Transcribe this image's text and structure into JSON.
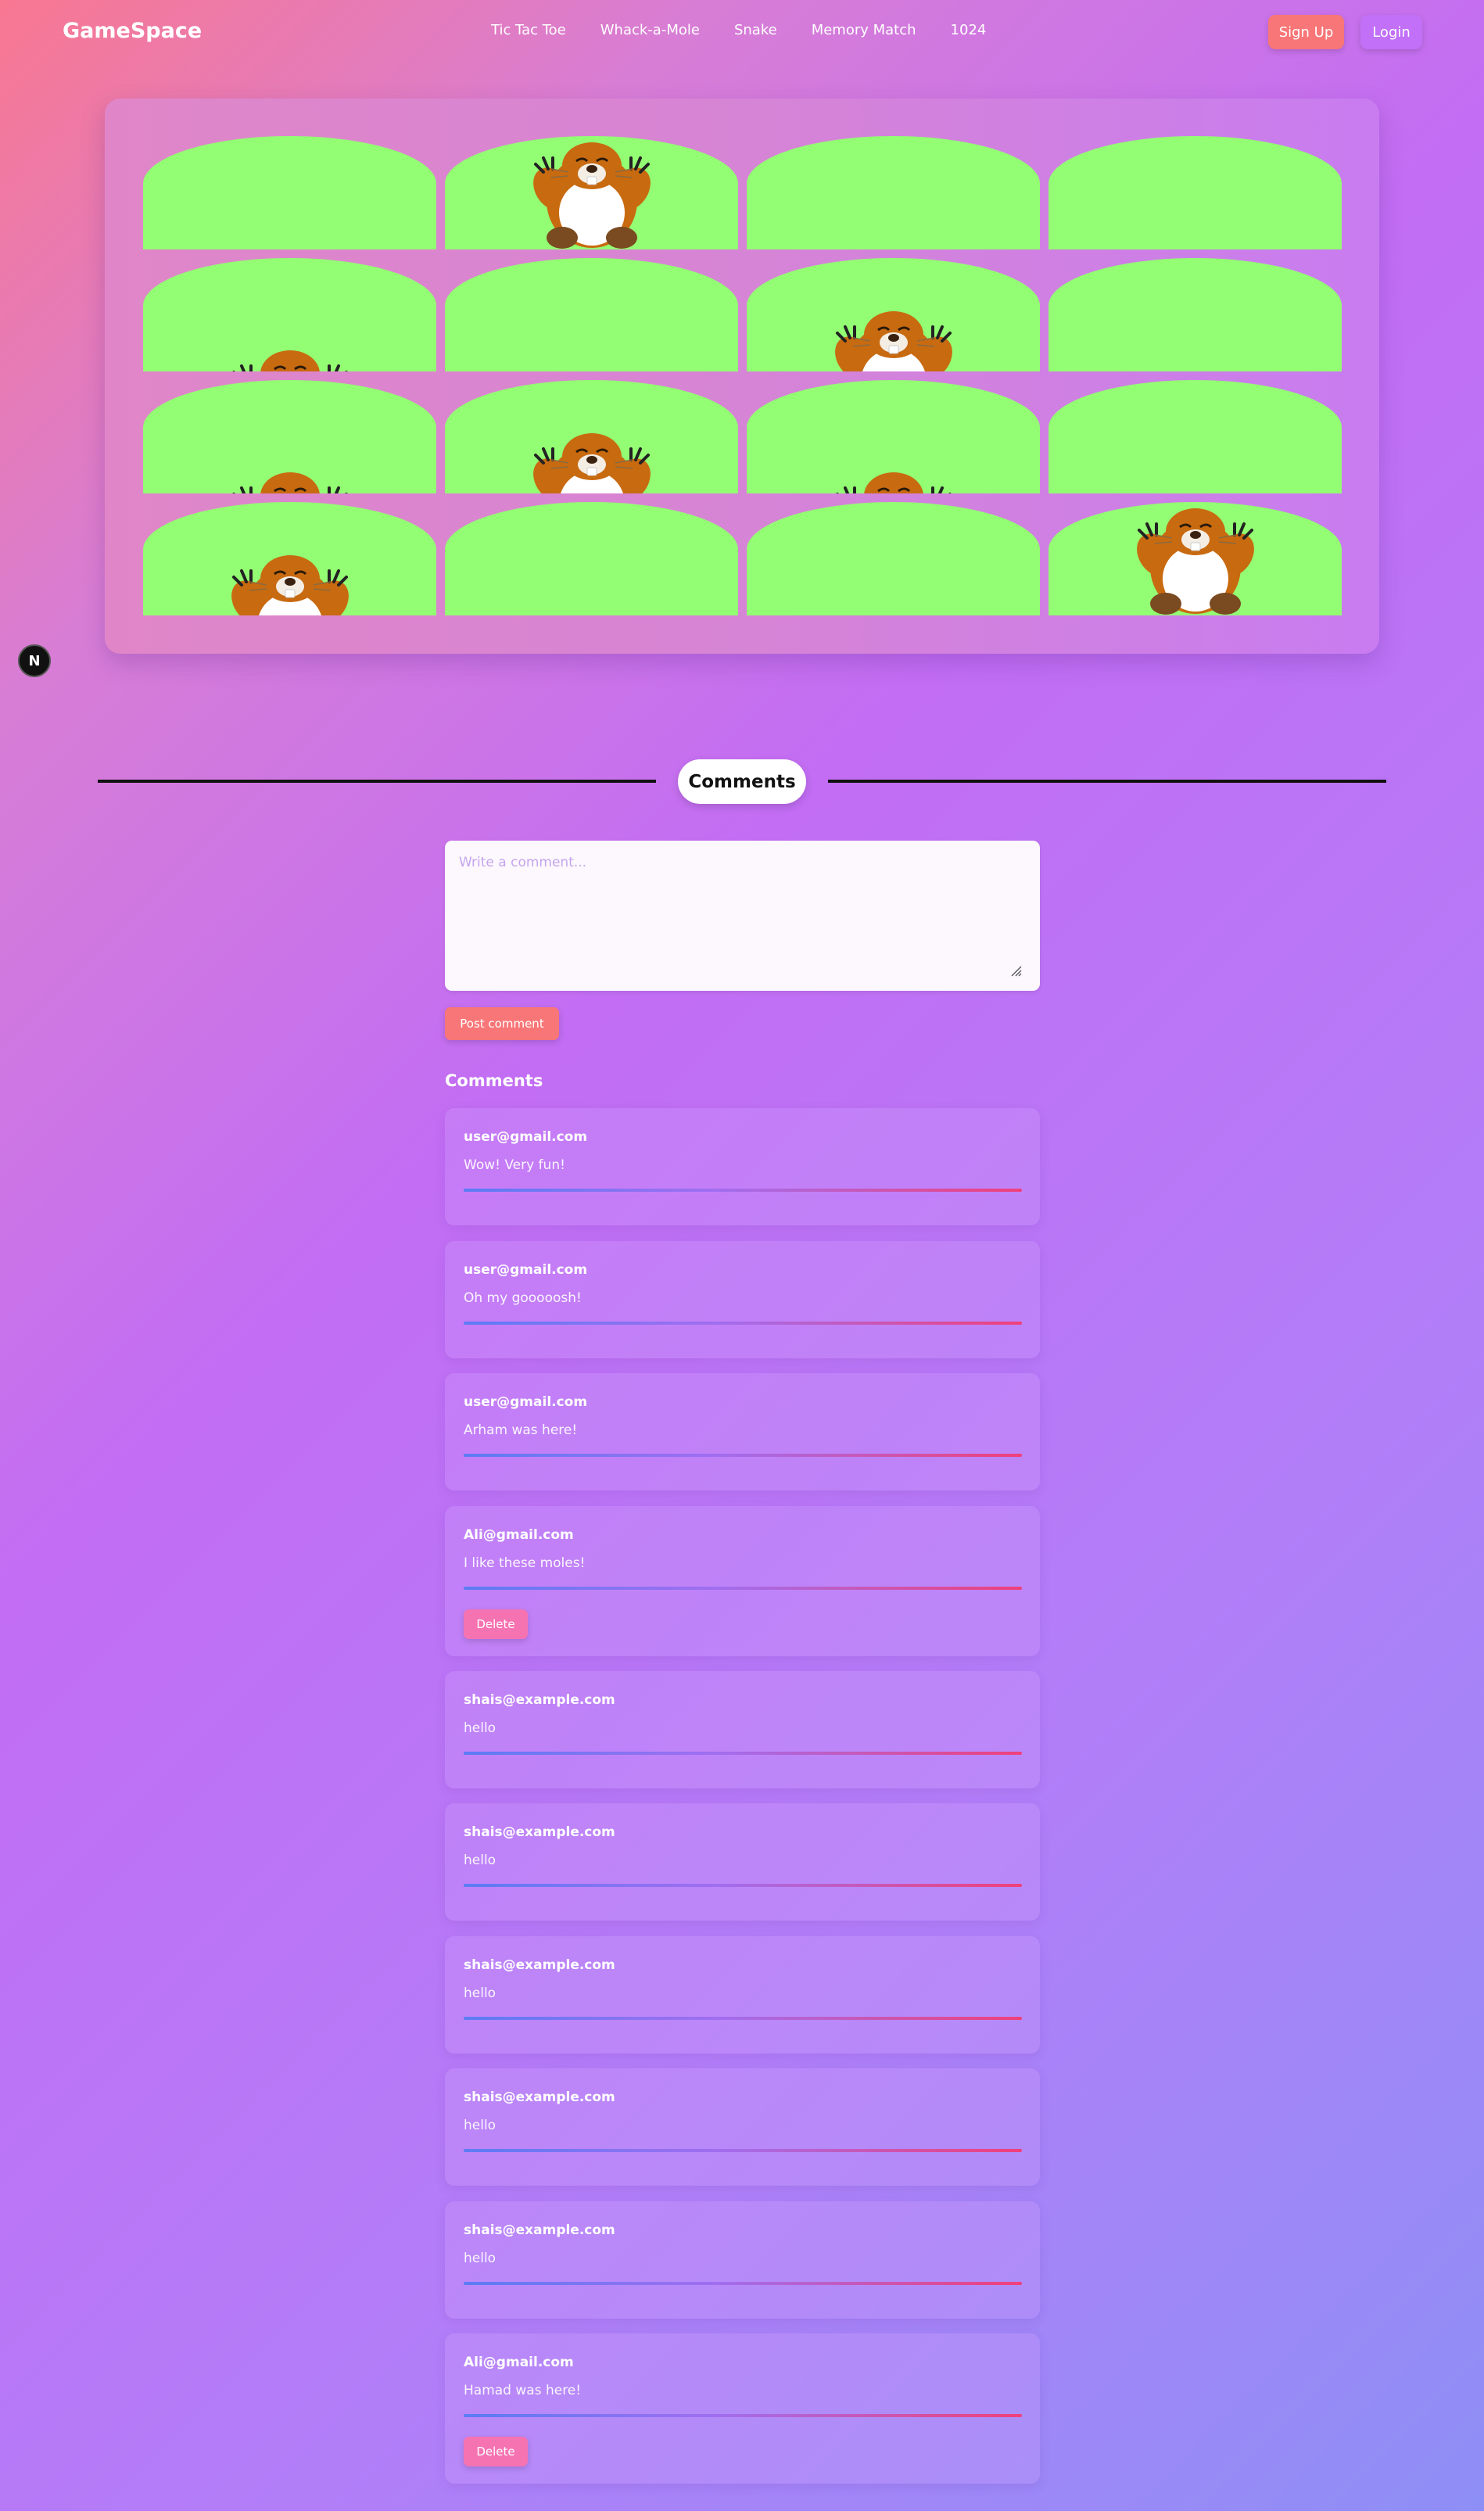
{
  "navbar": {
    "brand": "GameSpace",
    "links": [
      "Tic Tac Toe",
      "Whack-a-Mole",
      "Snake",
      "Memory Match",
      "1024"
    ],
    "signup_label": "Sign Up",
    "login_label": "Login"
  },
  "game": {
    "grid": [
      4,
      4
    ],
    "moles": [
      {
        "row": 0,
        "col": 1,
        "state": "full"
      },
      {
        "row": 1,
        "col": 0,
        "state": "peek"
      },
      {
        "row": 1,
        "col": 2,
        "state": "half"
      },
      {
        "row": 2,
        "col": 0,
        "state": "peek"
      },
      {
        "row": 2,
        "col": 1,
        "state": "half"
      },
      {
        "row": 2,
        "col": 2,
        "state": "peek"
      },
      {
        "row": 3,
        "col": 0,
        "state": "half"
      },
      {
        "row": 3,
        "col": 3,
        "state": "full"
      }
    ],
    "colors": {
      "grass": "#93fd73",
      "mole_fur": "#c86a10",
      "mole_belly": "#ffffff"
    }
  },
  "floating_badge": "N",
  "comments_section": {
    "divider_label": "Comments",
    "input_placeholder": "Write a comment...",
    "post_label": "Post comment",
    "list_heading": "Comments",
    "delete_label": "Delete",
    "items": [
      {
        "email": "user@gmail.com",
        "text": "Wow! Very fun!",
        "deletable": false
      },
      {
        "email": "user@gmail.com",
        "text": "Oh my gooooosh!",
        "deletable": false
      },
      {
        "email": "user@gmail.com",
        "text": "Arham was here!",
        "deletable": false
      },
      {
        "email": "Ali@gmail.com",
        "text": "I like these moles!",
        "deletable": true
      },
      {
        "email": "shais@example.com",
        "text": "hello",
        "deletable": false
      },
      {
        "email": "shais@example.com",
        "text": "hello",
        "deletable": false
      },
      {
        "email": "shais@example.com",
        "text": "hello",
        "deletable": false
      },
      {
        "email": "shais@example.com",
        "text": "hello",
        "deletable": false
      },
      {
        "email": "shais@example.com",
        "text": "hello",
        "deletable": false
      },
      {
        "email": "Ali@gmail.com",
        "text": "Hamad was here!",
        "deletable": true
      }
    ]
  }
}
